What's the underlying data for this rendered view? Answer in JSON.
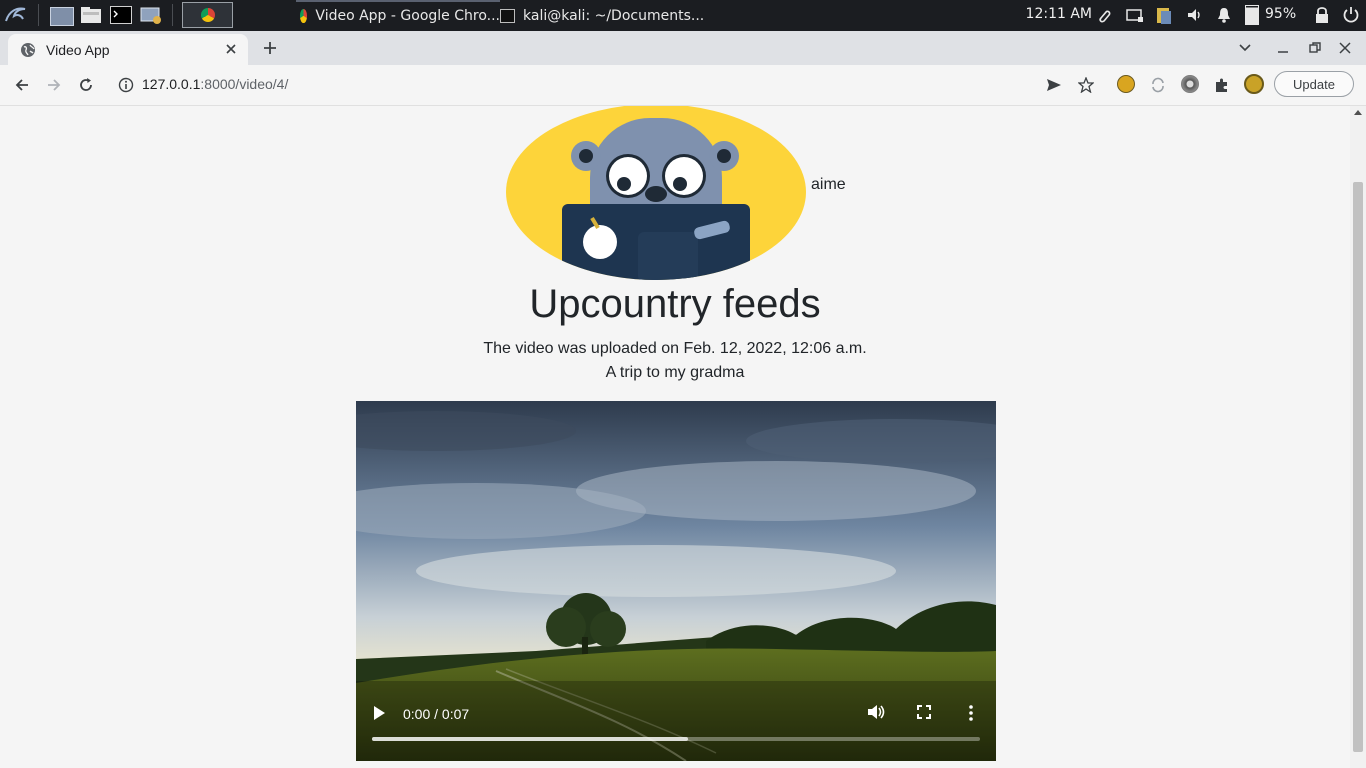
{
  "taskbar": {
    "tasks": [
      {
        "label": "Video App - Google Chro...",
        "icon": "chrome-icon"
      },
      {
        "label": "kali@kali: ~/Documents...",
        "icon": "terminal-icon"
      }
    ],
    "clock": "12:11 AM",
    "battery": "95%"
  },
  "browser": {
    "tab_title": "Video App",
    "url_host": "127.0.0.1",
    "url_path": ":8000/video/4/",
    "update_label": "Update"
  },
  "page": {
    "username": "aime",
    "title": "Upcountry feeds",
    "uploaded_text": "The video was uploaded on Feb. 12, 2022, 12:06 a.m.",
    "description": "A trip to my gradma",
    "video": {
      "time_display": "0:00 / 0:07",
      "buffered_fraction": 0.52
    }
  }
}
